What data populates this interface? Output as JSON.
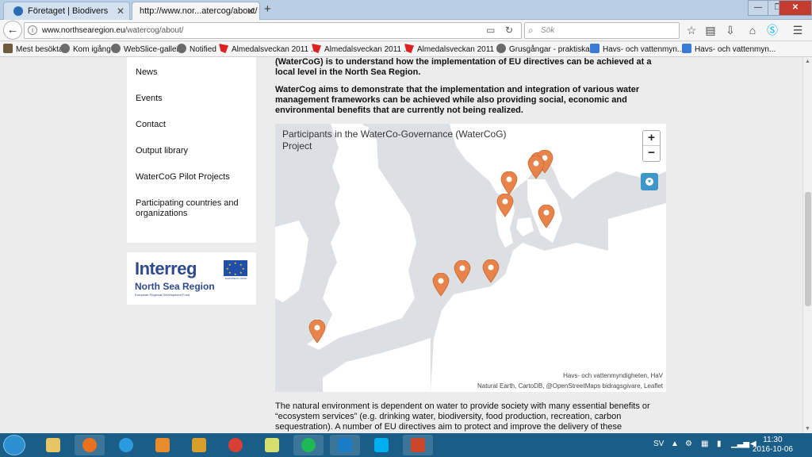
{
  "browser": {
    "tabs": [
      {
        "label": "Företaget | Biodivers"
      },
      {
        "label": "http://www.nor...atercog/about/"
      }
    ],
    "url": {
      "host": "www.northsearegion.eu",
      "path": "/watercog/about/"
    },
    "search_placeholder": "Sök",
    "window_controls": {
      "minimize": "—",
      "maximize": "❐",
      "close": "✕"
    },
    "bookmarks": [
      {
        "label": "Mest besökta"
      },
      {
        "label": "Kom igång"
      },
      {
        "label": "WebSlice-galleri"
      },
      {
        "label": "Notified"
      },
      {
        "label": "Almedalsveckan 2011 ..."
      },
      {
        "label": "Almedalsveckan 2011 ..."
      },
      {
        "label": "Almedalsveckan 2011 ..."
      },
      {
        "label": "Grusgångar - praktiska..."
      },
      {
        "label": "Havs- och vattenmyn..."
      },
      {
        "label": "Havs- och vattenmyn..."
      }
    ]
  },
  "sidebar": {
    "items": [
      {
        "label": "News"
      },
      {
        "label": "Events"
      },
      {
        "label": "Contact"
      },
      {
        "label": "Output library"
      },
      {
        "label": "WaterCoG Pilot Projects"
      },
      {
        "label": "Participating countries and organizations"
      }
    ]
  },
  "logo": {
    "name": "Interreg",
    "region": "North Sea Region",
    "fund": "European Regional Development Fund",
    "eu_label": "EUROPEAN UNION"
  },
  "content": {
    "lead_1": "(WaterCoG) is to understand how the implementation of EU directives can be achieved at a local level in the North Sea Region.",
    "lead_2": "WaterCog aims to demonstrate that the implementation and integration of various water management frameworks can be achieved while also providing social, economic and environmental benefits that are currently not being realized.",
    "body": "The natural environment is dependent on water to provide society with many essential benefits or “ecosystem services” (e.g. drinking water, biodiversity, food production, recreation, carbon sequestration). A number of EU directives aim to protect and improve the delivery of these services."
  },
  "map": {
    "title": "Participants in the WaterCo-Governance (WaterCoG) Project",
    "zoom_in": "+",
    "zoom_out": "−",
    "attribution_1": "Havs- och vattenmyndigheten, HaV",
    "attribution_2": "Natural Earth, CartoDB, @OpenStreetMaps bidragsgivare, Leaflet",
    "land_color": "#ffffff",
    "sea_color": "#dde0e3",
    "marker_color": "#e8834a",
    "marker_count": 10
  },
  "taskbar": {
    "language": "SV",
    "time": "11:30",
    "date": "2016-10-06"
  }
}
